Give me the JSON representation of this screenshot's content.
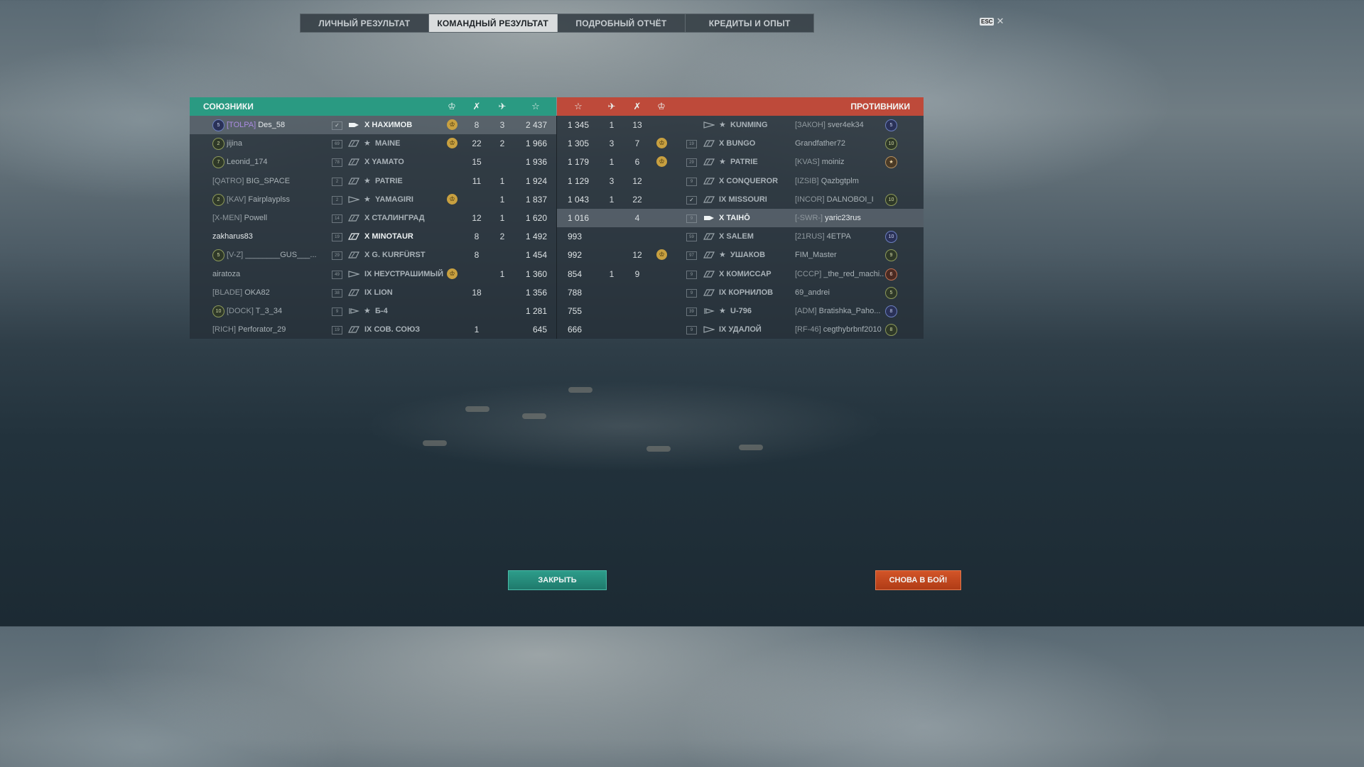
{
  "tabs": [
    "ЛИЧНЫЙ РЕЗУЛЬТАТ",
    "КОМАНДНЫЙ РЕЗУЛЬТАТ",
    "ПОДРОБНЫЙ ОТЧЁТ",
    "КРЕДИТЫ И ОПЫТ"
  ],
  "active_tab": 1,
  "esc_label": "ESC",
  "allies_title": "СОЮЗНИКИ",
  "enemies_title": "ПРОТИВНИКИ",
  "colors": {
    "allies": "#2a9a82",
    "enemies": "#be4a3a",
    "close_button": "#2d9c8a",
    "again_button": "#d25428"
  },
  "header_icons": [
    "kraken-icon",
    "crossed-swords-icon",
    "plane-icon",
    "star-icon"
  ],
  "allies": [
    {
      "badge": "5",
      "badge_style": "blue",
      "clan": "[TOLPA]",
      "clan_vip": true,
      "name": "Des_58",
      "level": "✓",
      "ship_icon": "cruiser",
      "premium": false,
      "ship": "X НАХИМОВ",
      "kraken": true,
      "frags": "8",
      "planes": "3",
      "xp": "2 437",
      "highlight": true
    },
    {
      "badge": "2",
      "badge_style": "green",
      "clan": "",
      "name": "jijina",
      "level": "69",
      "ship_icon": "battleship",
      "premium": true,
      "ship": "MAINE",
      "kraken": true,
      "frags": "22",
      "planes": "2",
      "xp": "1 966"
    },
    {
      "badge": "7",
      "badge_style": "green",
      "clan": "",
      "name": "Leonid_174",
      "level": "78",
      "ship_icon": "battleship",
      "premium": false,
      "ship": "X YAMATO",
      "kraken": false,
      "frags": "15",
      "planes": "",
      "xp": "1 936"
    },
    {
      "badge": "",
      "clan": "[QATRO]",
      "name": "BIG_SPACE",
      "level": "2",
      "ship_icon": "battleship",
      "premium": true,
      "ship": "PATRIE",
      "kraken": false,
      "frags": "11",
      "planes": "1",
      "xp": "1 924"
    },
    {
      "badge": "2",
      "badge_style": "green",
      "clan": "[KAV]",
      "name": "Fairplayplss",
      "level": "2",
      "ship_icon": "destroyer",
      "premium": true,
      "ship": "YAMAGIRI",
      "kraken": true,
      "frags": "",
      "planes": "1",
      "xp": "1 837"
    },
    {
      "badge": "",
      "clan": "[X-MEN]",
      "name": "Powell",
      "level": "14",
      "ship_icon": "battleship",
      "premium": false,
      "ship": "X СТАЛИНГРАД",
      "kraken": false,
      "frags": "12",
      "planes": "1",
      "xp": "1 620"
    },
    {
      "badge": "",
      "clan": "",
      "name": "zakharus83",
      "level": "19",
      "ship_icon": "battleship",
      "premium": false,
      "ship": "X MINOTAUR",
      "kraken": false,
      "frags": "8",
      "planes": "2",
      "xp": "1 492",
      "self": true
    },
    {
      "badge": "5",
      "badge_style": "green",
      "clan": "[V-Z]",
      "name": "________GUS___...",
      "level": "29",
      "ship_icon": "battleship",
      "premium": false,
      "ship": "X G. KURFÜRST",
      "kraken": false,
      "frags": "8",
      "planes": "",
      "xp": "1 454"
    },
    {
      "badge": "",
      "clan": "",
      "name": "airatoza",
      "level": "49",
      "ship_icon": "destroyer",
      "premium": false,
      "ship": "IX НЕУСТРАШИМЫЙ",
      "kraken": true,
      "frags": "",
      "planes": "1",
      "xp": "1 360"
    },
    {
      "badge": "",
      "clan": "[BLADE]",
      "name": "OKA82",
      "level": "38",
      "ship_icon": "battleship",
      "premium": false,
      "ship": "IX LION",
      "kraken": false,
      "frags": "18",
      "planes": "",
      "xp": "1 356"
    },
    {
      "badge": "10",
      "badge_style": "green",
      "clan": "[DOCK]",
      "name": "T_3_34",
      "level": "9",
      "ship_icon": "submarine",
      "premium": true,
      "ship": "Б-4",
      "kraken": false,
      "frags": "",
      "planes": "",
      "xp": "1 281"
    },
    {
      "badge": "",
      "clan": "[RICH]",
      "name": "Perforator_29",
      "level": "19",
      "ship_icon": "battleship",
      "premium": false,
      "ship": "IX СОВ. СОЮЗ",
      "kraken": false,
      "frags": "1",
      "planes": "",
      "xp": "645"
    }
  ],
  "enemies": [
    {
      "xp": "1 345",
      "planes": "1",
      "frags": "13",
      "kraken": false,
      "level": "",
      "ship_icon": "destroyer",
      "premium": true,
      "ship": "KUNMING",
      "clan": "[ЗАКОН]",
      "name": "sver4ek34",
      "badge": "5",
      "badge_style": "blue"
    },
    {
      "xp": "1 305",
      "planes": "3",
      "frags": "7",
      "kraken": true,
      "level": "19",
      "ship_icon": "battleship",
      "premium": false,
      "ship": "X BUNGO",
      "clan": "",
      "name": "Grandfather72",
      "badge": "10",
      "badge_style": "green"
    },
    {
      "xp": "1 179",
      "planes": "1",
      "frags": "6",
      "kraken": true,
      "level": "29",
      "ship_icon": "battleship",
      "premium": true,
      "ship": "PATRIE",
      "clan": "[KVAS]",
      "name": "moiniz",
      "badge": "★",
      "badge_style": "star"
    },
    {
      "xp": "1 129",
      "planes": "3",
      "frags": "12",
      "kraken": false,
      "level": "9",
      "ship_icon": "battleship",
      "premium": false,
      "ship": "X CONQUEROR",
      "clan": "[IZSIB]",
      "name": "Qazbgtplm",
      "badge": "",
      "badge_style": ""
    },
    {
      "xp": "1 043",
      "planes": "1",
      "frags": "22",
      "kraken": false,
      "level": "✓",
      "ship_icon": "battleship",
      "premium": false,
      "ship": "IX MISSOURI",
      "clan": "[INCOR]",
      "name": "DALNOBOI_I",
      "badge": "10",
      "badge_style": "green"
    },
    {
      "xp": "1 016",
      "planes": "",
      "frags": "4",
      "kraken": false,
      "level": "9",
      "ship_icon": "cruiser",
      "premium": false,
      "ship": "X TAIHŌ",
      "clan": "[-SWR-]",
      "name": "yaric23rus",
      "badge": "",
      "badge_style": "",
      "highlight": true
    },
    {
      "xp": "993",
      "planes": "",
      "frags": "",
      "kraken": false,
      "level": "59",
      "ship_icon": "battleship",
      "premium": false,
      "ship": "X SALEM",
      "clan": "[21RUS]",
      "name": "4ETPA",
      "badge": "10",
      "badge_style": "blue"
    },
    {
      "xp": "992",
      "planes": "",
      "frags": "12",
      "kraken": true,
      "level": "97",
      "ship_icon": "battleship",
      "premium": true,
      "ship": "УШАКОВ",
      "clan": "",
      "name": "FIM_Master",
      "badge": "9",
      "badge_style": "green"
    },
    {
      "xp": "854",
      "planes": "1",
      "frags": "9",
      "kraken": false,
      "level": "9",
      "ship_icon": "battleship",
      "premium": false,
      "ship": "X КОМИССАР",
      "clan": "[CCCP]",
      "name": "_the_red_machi...",
      "badge": "6",
      "badge_style": "red"
    },
    {
      "xp": "788",
      "planes": "",
      "frags": "",
      "kraken": false,
      "level": "9",
      "ship_icon": "battleship",
      "premium": false,
      "ship": "IX КОРНИЛОВ",
      "clan": "",
      "name": "69_andrei",
      "badge": "5",
      "badge_style": "green"
    },
    {
      "xp": "755",
      "planes": "",
      "frags": "",
      "kraken": false,
      "level": "39",
      "ship_icon": "submarine",
      "premium": true,
      "ship": "U-796",
      "clan": "[ADM]",
      "name": "Bratishka_Paho...",
      "badge": "8",
      "badge_style": "blue"
    },
    {
      "xp": "666",
      "planes": "",
      "frags": "",
      "kraken": false,
      "level": "9",
      "ship_icon": "destroyer",
      "premium": false,
      "ship": "IX УДАЛОЙ",
      "clan": "[RF-46]",
      "name": "cegthybrbnf2010",
      "badge": "8",
      "badge_style": "green"
    }
  ],
  "buttons": {
    "close": "ЗАКРЫТЬ",
    "again": "СНОВА В БОЙ!"
  }
}
